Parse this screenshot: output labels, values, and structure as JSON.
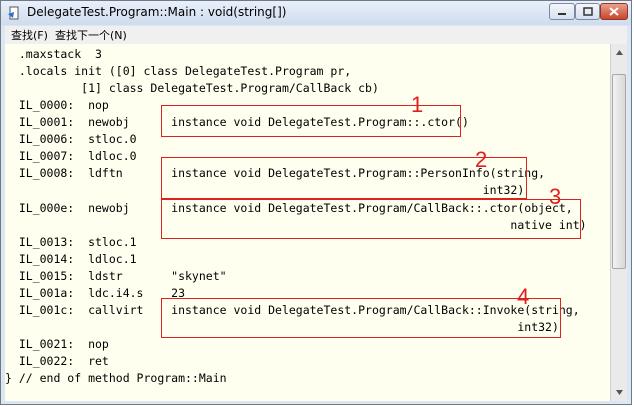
{
  "window": {
    "title": "DelegateTest.Program::Main : void(string[])",
    "controls": {
      "minimize_icon": "minimize-icon",
      "maximize_icon": "maximize-icon",
      "close_icon": "close-icon"
    }
  },
  "menu": [
    {
      "label": "查找(F)"
    },
    {
      "label": "查找下一个(N)"
    }
  ],
  "code": {
    "lines": [
      "  .maxstack  3",
      "  .locals init ([0] class DelegateTest.Program pr,",
      "           [1] class DelegateTest.Program/CallBack cb)",
      "  IL_0000:  nop",
      "  IL_0001:  newobj      instance void DelegateTest.Program::.ctor()",
      "  IL_0006:  stloc.0",
      "  IL_0007:  ldloc.0",
      "  IL_0008:  ldftn       instance void DelegateTest.Program::PersonInfo(string,",
      "                                                                     int32)",
      "  IL_000e:  newobj      instance void DelegateTest.Program/CallBack::.ctor(object,",
      "                                                                         native int)",
      "  IL_0013:  stloc.1",
      "  IL_0014:  ldloc.1",
      "  IL_0015:  ldstr       \"skynet\"",
      "  IL_001a:  ldc.i4.s    23",
      "  IL_001c:  callvirt    instance void DelegateTest.Program/CallBack::Invoke(string,",
      "                                                                          int32)",
      "  IL_0021:  nop",
      "  IL_0022:  ret",
      "} // end of method Program::Main"
    ]
  },
  "annotations": [
    {
      "number": "1"
    },
    {
      "number": "2"
    },
    {
      "number": "3"
    },
    {
      "number": "4"
    }
  ],
  "colors": {
    "annotation": "#e02020",
    "editor_background": "#fffff0"
  },
  "scrollbar": {
    "position": 0.1
  }
}
